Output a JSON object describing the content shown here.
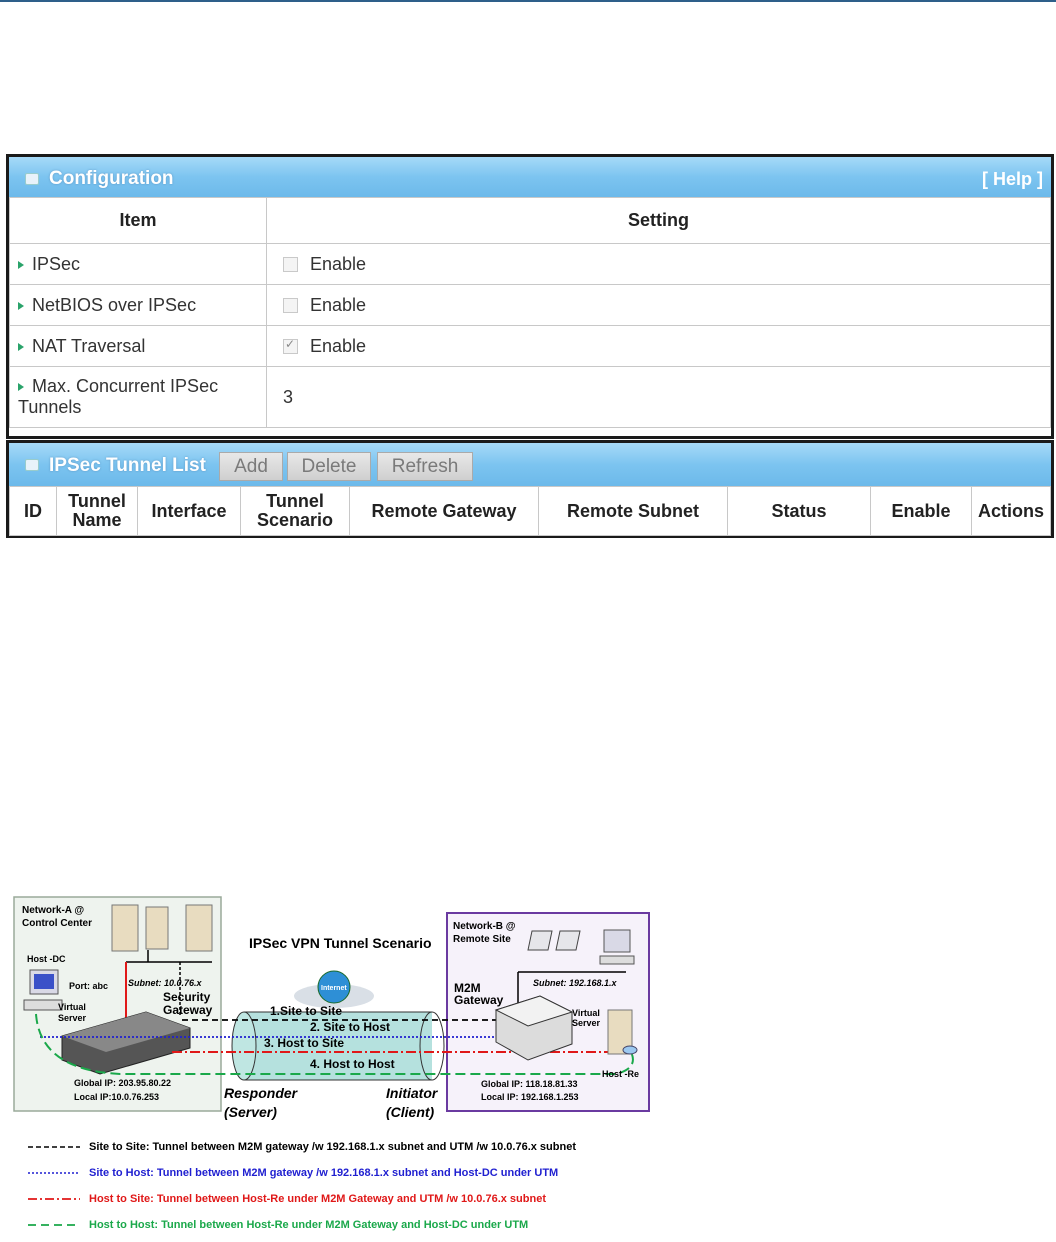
{
  "config": {
    "title": "Configuration",
    "help": "[ Help ]",
    "col_item": "Item",
    "col_setting": "Setting",
    "rows": [
      {
        "label": "IPSec",
        "value": "Enable",
        "checked": false
      },
      {
        "label": "NetBIOS over IPSec",
        "value": "Enable",
        "checked": false
      },
      {
        "label": "NAT Traversal",
        "value": "Enable",
        "checked": true
      },
      {
        "label": "Max. Concurrent IPSec Tunnels",
        "value": "3"
      }
    ]
  },
  "tunnel_list": {
    "title": "IPSec Tunnel List",
    "add": "Add",
    "delete": "Delete",
    "refresh": "Refresh",
    "columns": [
      "ID",
      "Tunnel Name",
      "Interface",
      "Tunnel Scenario",
      "Remote Gateway",
      "Remote Subnet",
      "Status",
      "Enable",
      "Actions"
    ]
  },
  "diagram": {
    "title": "IPSec VPN Tunnel Scenario",
    "network_a": "Network-A @ Control Center",
    "network_b": "Network-B @ Remote Site",
    "host_dc": "Host -DC",
    "port": "Port: abc",
    "virtual_server_a": "Virtual Server",
    "subnet_a": "Subnet: 10.0.76.x",
    "security_gateway": "Security Gateway",
    "internet": "Internet",
    "global_ip_a": "Global IP: 203.95.80.22",
    "local_ip_a": "Local IP:10.0.76.253",
    "m2m_gateway": "M2M Gateway",
    "subnet_b": "Subnet: 192.168.1.x",
    "virtual_server_b": "Virtual Server",
    "host_re": "Host -Re",
    "global_ip_b": "Global IP: 118.18.81.33",
    "local_ip_b": "Local IP: 192.168.1.253",
    "tunnel1": "1.Site to Site",
    "tunnel2": "2. Site to Host",
    "tunnel3": "3. Host to Site",
    "tunnel4": "4. Host to Host",
    "responder": "Responder",
    "responder_sub": "(Server)",
    "initiator": "Initiator",
    "initiator_sub": "(Client)",
    "legend": [
      {
        "text": "Site to Site: Tunnel between M2M gateway  /w 192.168.1.x subnet and  UTM /w 10.0.76.x subnet",
        "color": "#000000"
      },
      {
        "text": "Site to Host: Tunnel between M2M gateway /w 192.168.1.x subnet and Host-DC under UTM",
        "color": "#1f1fd0"
      },
      {
        "text": "Host to Site: Tunnel between Host-Re under M2M Gateway and UTM /w 10.0.76.x subnet",
        "color": "#e01818"
      },
      {
        "text": "Host to Host: Tunnel between Host-Re under M2M Gateway and Host-DC under UTM",
        "color": "#1aa84a"
      }
    ]
  }
}
